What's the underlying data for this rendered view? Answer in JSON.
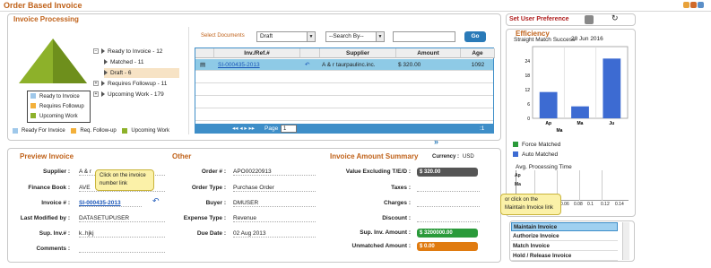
{
  "window": {
    "title": "Order Based Invoice"
  },
  "invoice_processing": {
    "title": "Invoice Processing",
    "tree": [
      {
        "label": "Ready to Invoice - 12"
      },
      {
        "label": "Matched - 11"
      },
      {
        "label": "Draft - 6"
      },
      {
        "label": "Requires Followup - 11"
      },
      {
        "label": "Upcoming Work - 179"
      }
    ],
    "legend": [
      "Ready to Invoice",
      "Requires Followup",
      "Upcoming Work"
    ],
    "bottom_legend": [
      "Ready For Invoice",
      "Req. Follow-up",
      "Upcoming Work"
    ]
  },
  "documents": {
    "select_label": "Select Documents",
    "doc_type": "Draft",
    "search_by": "--Search By--",
    "search_value": "",
    "go_label": "Go",
    "columns": [
      "Inv./Ref.#",
      "Supplier",
      "Amount",
      "Age"
    ],
    "rows": [
      {
        "ref": "SI-000435-2013",
        "supplier": "A & r taurpaulinc.inc.",
        "amount": "$ 320.00",
        "age": "1092"
      }
    ],
    "pager": {
      "page_label": "Page",
      "page": "1",
      "count": ":1"
    }
  },
  "preferences": {
    "title": "Set User Preference"
  },
  "efficiency": {
    "title": "Efficiency",
    "subtitle": "Straight Match Success",
    "date": "28 Jun 2016",
    "legend": [
      "Force Matched",
      "Auto Matched"
    ],
    "processing_title": "Avg. Processing Time",
    "processing_rows": [
      "Ap",
      "Ma"
    ],
    "processing_ticks": [
      "0.06",
      "0.08",
      "0.1",
      "0.12",
      "0.14"
    ]
  },
  "chart_data": {
    "type": "bar",
    "title": "Straight Match Success",
    "categories": [
      "Ap",
      "Ma",
      "Ju"
    ],
    "xlabel": "Ma",
    "values": [
      11,
      5,
      25
    ],
    "yticks": [
      0,
      6,
      12,
      18,
      24
    ],
    "ylim": [
      0,
      30
    ],
    "color": "#3d6bd2"
  },
  "preview": {
    "title": "Preview Invoice",
    "fields": [
      {
        "label": "Supplier :",
        "value": "A & r"
      },
      {
        "label": "Finance Book :",
        "value": "AVE"
      },
      {
        "label": "Invoice # :",
        "value": "SI-000435-2013"
      },
      {
        "label": "Last Modified by :",
        "value": "DATASETUPUSER"
      },
      {
        "label": "Sup. Inv.# :",
        "value": "k..hjkj"
      },
      {
        "label": "Comments :",
        "value": ""
      }
    ],
    "callout": "Click on the invoice number link"
  },
  "other": {
    "title": "Other",
    "fields": [
      {
        "label": "Order # :",
        "value": "APO00220913"
      },
      {
        "label": "Order Type :",
        "value": "Purchase Order"
      },
      {
        "label": "Buyer :",
        "value": "DMUSER"
      },
      {
        "label": "Expense Type :",
        "value": "Revenue"
      },
      {
        "label": "Due Date :",
        "value": "02 Aug 2013"
      }
    ]
  },
  "amount_summary": {
    "title": "Invoice Amount Summary",
    "currency_label": "Currency :",
    "currency": "USD",
    "fields": [
      {
        "label": "Value Excluding T/E/D :",
        "value": "$ 320.00"
      },
      {
        "label": "Taxes :",
        "value": ""
      },
      {
        "label": "Charges :",
        "value": ""
      },
      {
        "label": "Discount :",
        "value": ""
      },
      {
        "label": "Sup. Inv. Amount :",
        "value": "$ 3200000.00"
      },
      {
        "label": "Unmatched Amount :",
        "value": "$ 0.00"
      }
    ],
    "colors": {
      "grey": "#555555",
      "green": "#2a9a3a",
      "orange": "#e07b10"
    }
  },
  "maintain": {
    "callout": "or click on the Maintain Invoice link",
    "items": [
      "Maintain Invoice",
      "Authorize Invoice",
      "Match Invoice",
      "Hold / Release Invoice"
    ]
  }
}
